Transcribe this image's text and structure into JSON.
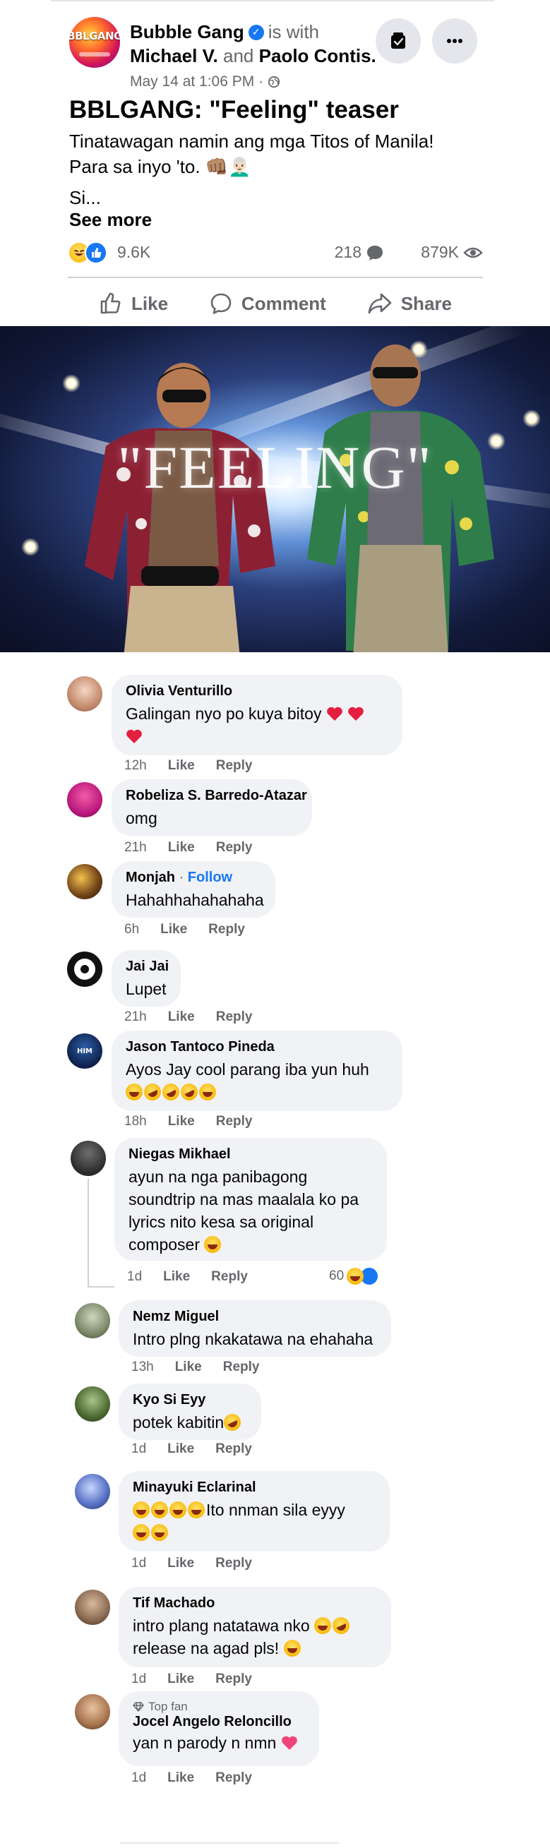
{
  "post": {
    "page_name": "Bubble Gang",
    "avatar_text": "BBLGANG",
    "with_text": "is with",
    "tagged_1": "Michael V.",
    "and_text": "and",
    "tagged_2": "Paolo Contis.",
    "timestamp": "May 14 at 1:06 PM ·",
    "title": "BBLGANG: \"Feeling\" teaser",
    "body_line_1": "Tinatawagan namin ang mga Titos of Manila!",
    "body_line_2": "Para sa inyo 'to. 👊🏽👨🏻‍🦳",
    "body_line_3": "Si...",
    "see_more": "See more",
    "reaction_count": "9.6K",
    "comment_count": "218",
    "view_count": "879K",
    "actions": {
      "like": "Like",
      "comment": "Comment",
      "share": "Share"
    },
    "video_title": "\"FEELING\""
  },
  "icons": {
    "verified": "verified-badge-icon",
    "globe": "globe-icon",
    "like": "thumbs-up-icon",
    "comment": "speech-bubble-icon",
    "share": "share-arrow-icon",
    "more": "more-dots-icon",
    "storefront": "messenger-box-icon"
  },
  "colors": {
    "accent": "#1877f2",
    "muted": "#65676b",
    "bubble": "#f0f2f5"
  },
  "comments": [
    {
      "name": "Olivia Venturillo",
      "text": "Galingan nyo po kuya bitoy",
      "time": "12h",
      "like": "Like",
      "reply": "Reply"
    },
    {
      "name": "Robeliza S. Barredo-Atazar",
      "text": "omg",
      "time": "21h",
      "like": "Like",
      "reply": "Reply"
    },
    {
      "name": "Monjah",
      "follow": "Follow",
      "text": "Hahahhahahahaha",
      "time": "6h",
      "like": "Like",
      "reply": "Reply"
    },
    {
      "name": "Jai Jai",
      "text": "Lupet",
      "time": "21h",
      "like": "Like",
      "reply": "Reply"
    },
    {
      "name": "Jason Tantoco Pineda",
      "text": "Ayos Jay cool parang iba yun huh",
      "time": "18h",
      "like": "Like",
      "reply": "Reply"
    },
    {
      "name": "Niegas Mikhael",
      "text_1": "ayun na nga panibagong",
      "text_2": "soundtrip na mas maalala ko pa",
      "text_3": "lyrics nito kesa sa original",
      "text_4": "composer",
      "time": "1d",
      "like": "Like",
      "reply": "Reply",
      "reactions": "60"
    },
    {
      "name": "Nemz Miguel",
      "text": "Intro plng nkakatawa na ehahaha",
      "time": "13h",
      "like": "Like",
      "reply": "Reply"
    },
    {
      "name": "Kyo Si Eyy",
      "text": "potek kabitin",
      "time": "1d",
      "like": "Like",
      "reply": "Reply"
    },
    {
      "name": "Minayuki Eclarinal",
      "text": "Ito nnman sila eyyy",
      "time": "1d",
      "like": "Like",
      "reply": "Reply"
    },
    {
      "name": "Tif Machado",
      "text_1": "intro plang natatawa nko",
      "text_2": "release na agad pls!",
      "time": "1d",
      "like": "Like",
      "reply": "Reply"
    },
    {
      "name": "Jocel Angelo Reloncillo",
      "badge": "Top fan",
      "text": "yan n parody n nmn",
      "time": "1d",
      "like": "Like",
      "reply": "Reply"
    }
  ]
}
